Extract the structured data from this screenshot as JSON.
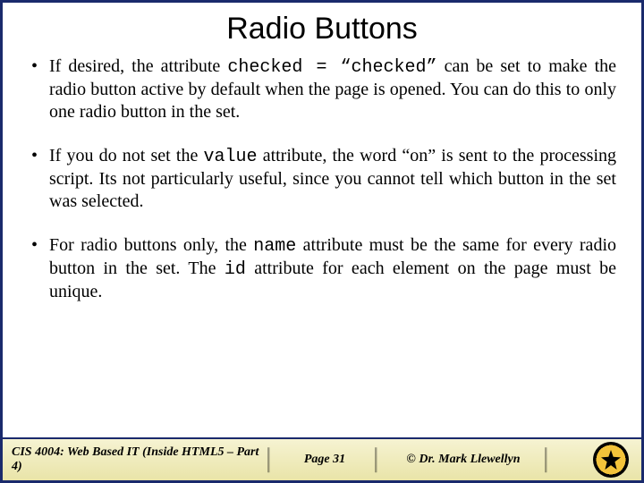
{
  "title": "Radio Buttons",
  "bullets": [
    {
      "pre": "If desired, the attribute ",
      "code": "checked = “checked”",
      "post": " can be set to make the radio button active by default when the page is opened. You can do this to only one radio button in the set."
    },
    {
      "pre": "If you do not set the ",
      "code": "value",
      "post": " attribute, the word “on” is sent to the processing script.  Its not particularly useful, since you cannot tell which button in the set was selected."
    }
  ],
  "bullet3": {
    "p1": "For radio buttons only, the ",
    "c1": "name",
    "p2": " attribute must be the same for every radio button in the set.  The ",
    "c2": "id",
    "p3": " attribute for each element on the page must be unique."
  },
  "footer": {
    "course": "CIS 4004: Web Based IT (Inside HTML5 – Part 4)",
    "page": "Page 31",
    "copyright": "© Dr. Mark Llewellyn"
  }
}
